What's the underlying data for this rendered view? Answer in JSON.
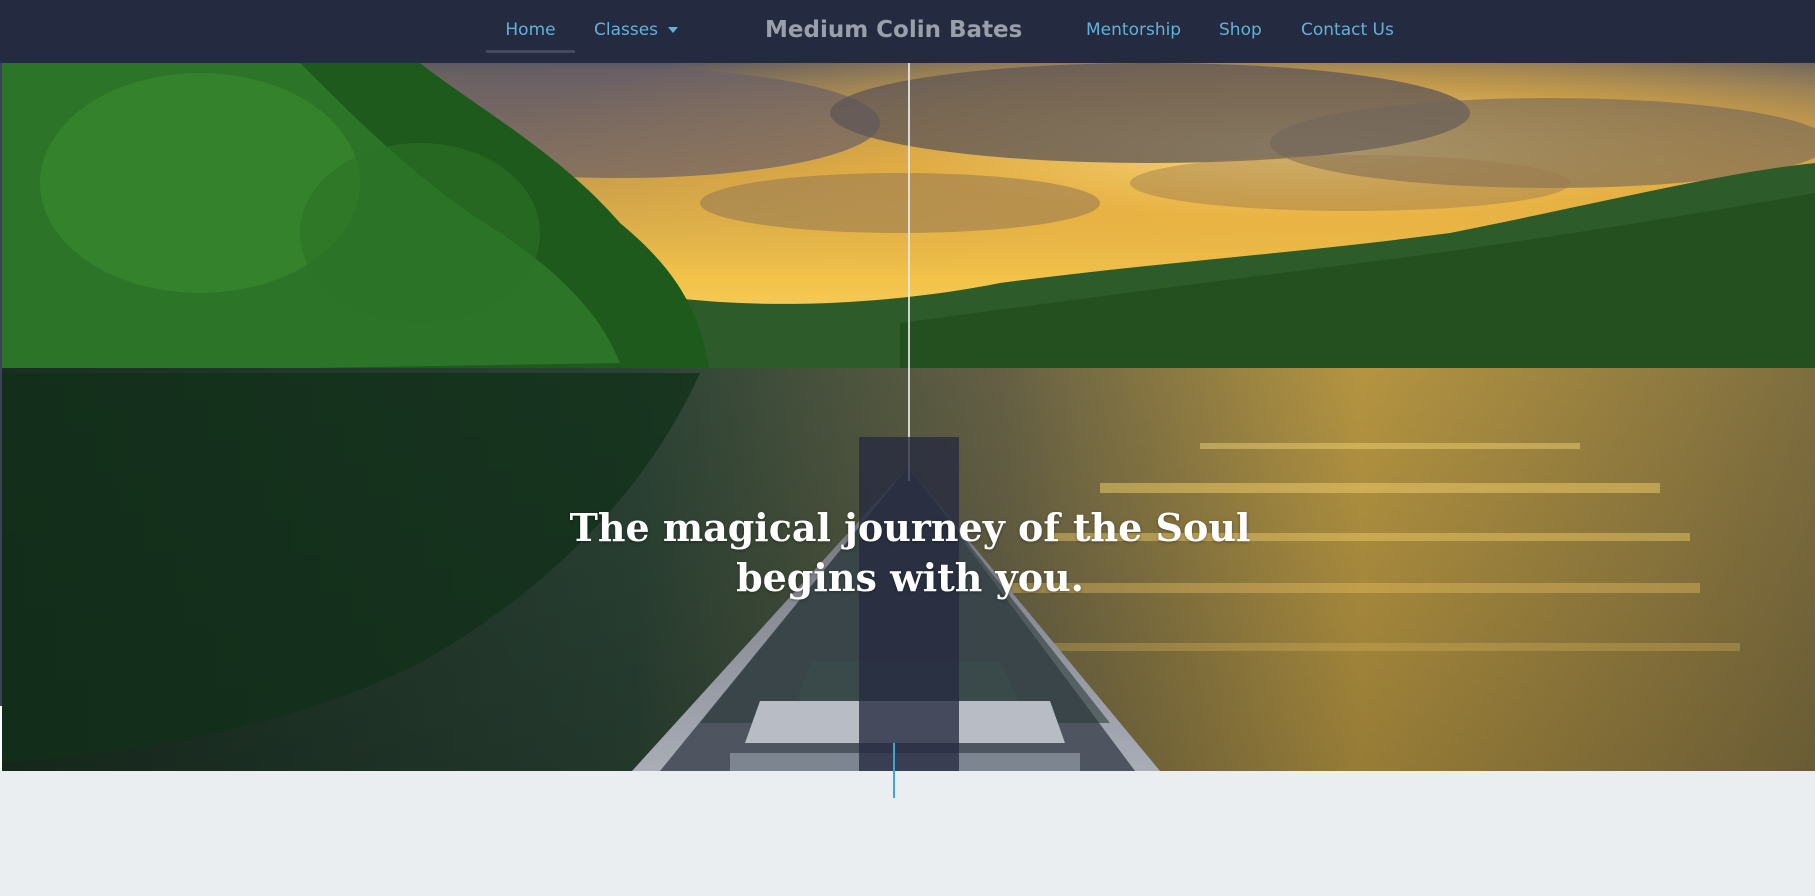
{
  "nav": {
    "brand": "Medium Colin Bates",
    "items": [
      {
        "label": "Home",
        "active": true
      },
      {
        "label": "Classes",
        "has_dropdown": true
      },
      {
        "label": "Mentorship"
      },
      {
        "label": "Shop"
      },
      {
        "label": "Contact Us"
      }
    ],
    "active_underline_color": "#434a5e",
    "link_color": "#62b2d8",
    "background": "#242a40"
  },
  "hero": {
    "headline_line1": "The magical journey of the Soul",
    "headline_line2": "begins with you.",
    "image": "lake-canoe-sunset-photo"
  },
  "page": {
    "background": "#ebeef1",
    "scroll_indicator_color": "#3aa6d6"
  }
}
